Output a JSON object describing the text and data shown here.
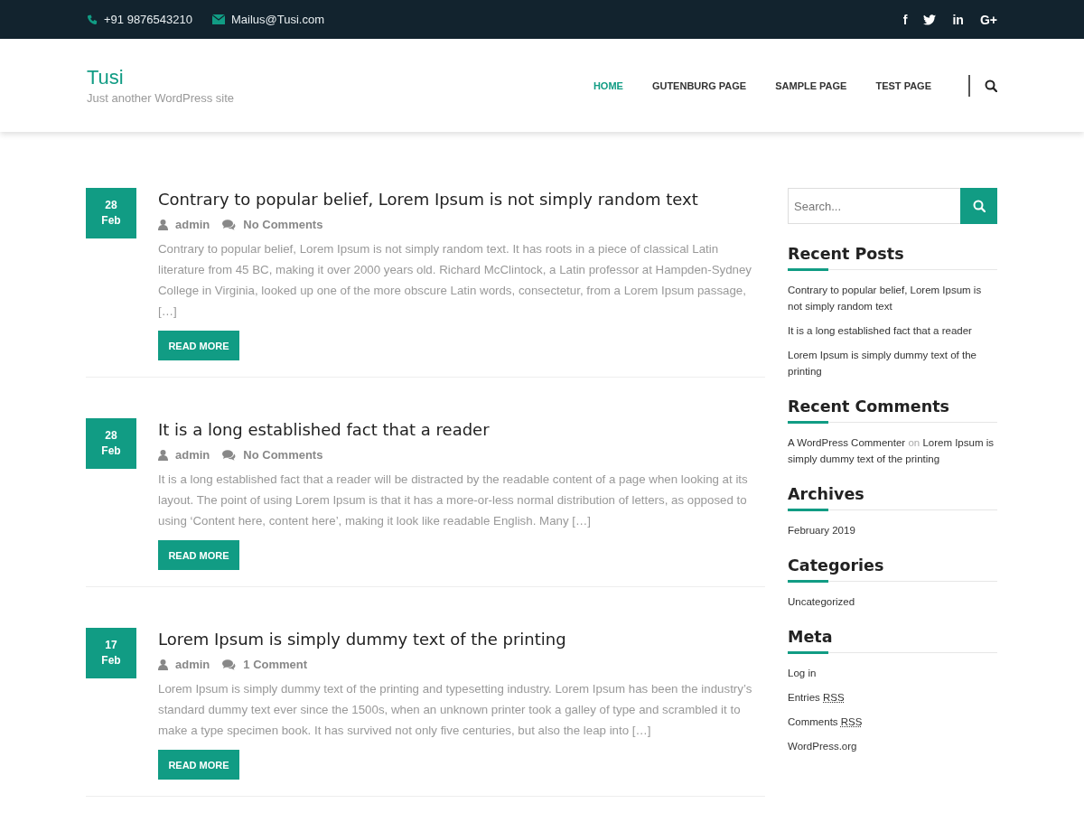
{
  "top_bar": {
    "phone": "+91 9876543210",
    "email": "Mailus@Tusi.com",
    "social": [
      {
        "kind": "text",
        "label": "f"
      },
      {
        "kind": "bird"
      },
      {
        "kind": "text",
        "label": "in"
      },
      {
        "kind": "text",
        "label": "G+"
      }
    ]
  },
  "header": {
    "site_title": "Tusi",
    "tagline": "Just another WordPress site",
    "nav": [
      {
        "label": "HOME",
        "selected": true
      },
      {
        "label": "GUTENBURG PAGE",
        "selected": false
      },
      {
        "label": "SAMPLE PAGE",
        "selected": false
      },
      {
        "label": "TEST PAGE",
        "selected": false
      }
    ]
  },
  "posts": [
    {
      "day": "28",
      "month": "Feb",
      "title": "Contrary to popular belief, Lorem Ipsum is not simply random text",
      "author": "admin",
      "comments": "No Comments",
      "excerpt": "Contrary to popular belief, Lorem Ipsum is not simply random text. It has roots in a piece of classical Latin literature from 45 BC, making it over 2000 years old. Richard McClintock, a Latin professor at Hampden-Sydney College in Virginia, looked up one of the more obscure Latin words, consectetur, from a Lorem Ipsum passage, […]",
      "button": "READ MORE"
    },
    {
      "day": "28",
      "month": "Feb",
      "title": "It is a long established fact that a reader",
      "author": "admin",
      "comments": "No Comments",
      "excerpt": "It is a long established fact that a reader will be distracted by the readable content of a page when looking at its layout. The point of using Lorem Ipsum is that it has a more-or-less normal distribution of letters, as opposed to using ‘Content here, content here’, making it look like readable English. Many […]",
      "button": "READ MORE"
    },
    {
      "day": "17",
      "month": "Feb",
      "title": "Lorem Ipsum is simply dummy text of the printing",
      "author": "admin",
      "comments": "1 Comment",
      "excerpt": "Lorem Ipsum is simply dummy text of the printing and typesetting industry. Lorem Ipsum has been the industry’s standard dummy text ever since the 1500s, when an unknown printer took a galley of type and scrambled it to make a type specimen book. It has survived not only five centuries, but also the leap into […]",
      "button": "READ MORE"
    }
  ],
  "sidebar": {
    "search": {
      "placeholder": "Search..."
    },
    "widgets": [
      {
        "title": "Recent Posts",
        "kind": "links",
        "items": [
          "Contrary to popular belief, Lorem Ipsum is not simply random text",
          "It is a long established fact that a reader",
          "Lorem Ipsum is simply dummy text of the printing"
        ]
      },
      {
        "title": "Recent Comments",
        "kind": "comments",
        "items": [
          {
            "author": "A WordPress Commenter",
            "joiner": "on",
            "post": "Lorem Ipsum is simply dummy text of the printing"
          }
        ]
      },
      {
        "title": "Archives",
        "kind": "links",
        "items": [
          "February 2019"
        ]
      },
      {
        "title": "Categories",
        "kind": "links",
        "items": [
          "Uncategorized"
        ]
      },
      {
        "title": "Meta",
        "kind": "meta",
        "items": [
          {
            "label": "Log in"
          },
          {
            "label": "Entries",
            "abbr": "RSS"
          },
          {
            "label": "Comments",
            "abbr": "RSS"
          },
          {
            "label": "WordPress.org"
          }
        ]
      }
    ]
  }
}
